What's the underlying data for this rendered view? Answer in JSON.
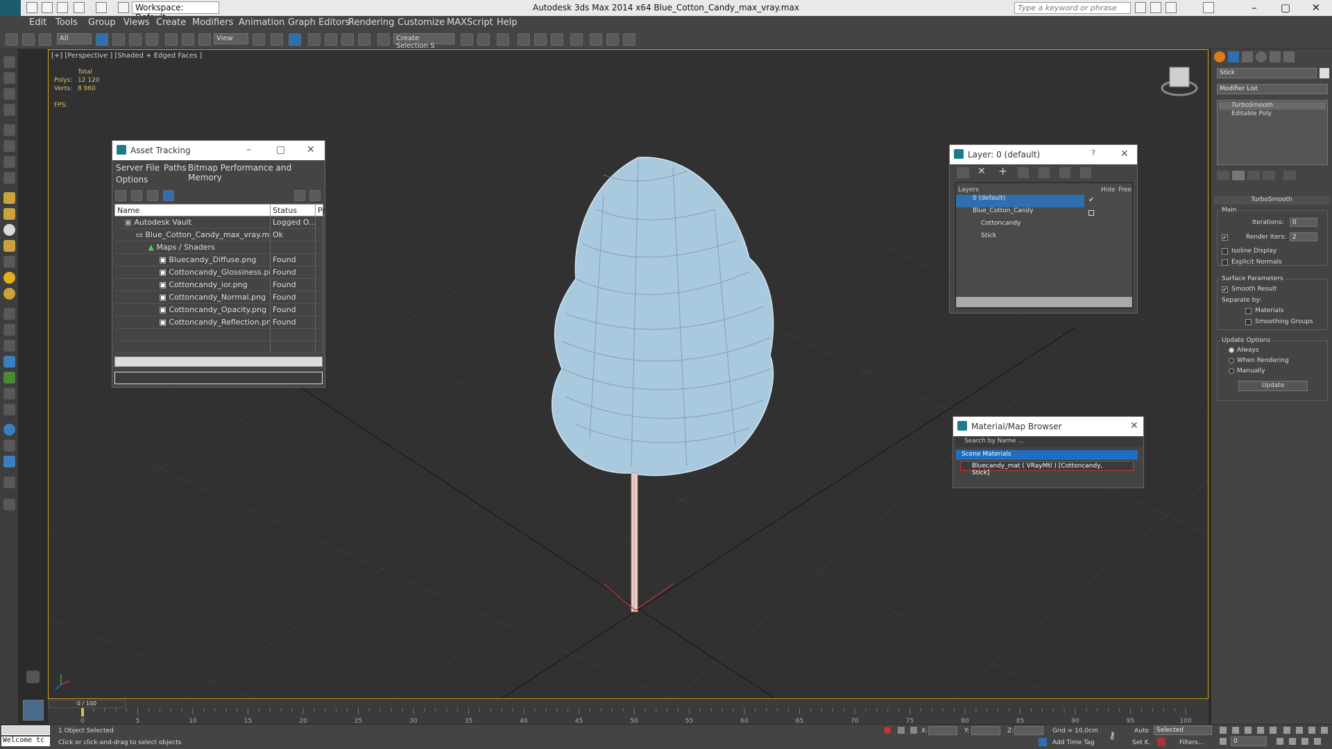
{
  "app": {
    "window_title": "Autodesk 3ds Max  2014 x64      Blue_Cotton_Candy_max_vray.max",
    "workspace": "Workspace: Default",
    "search_placeholder": "Type a keyword or phrase"
  },
  "menu": [
    "Edit",
    "Tools",
    "Group",
    "Views",
    "Create",
    "Modifiers",
    "Animation",
    "Graph Editors",
    "Rendering",
    "Customize",
    "MAXScript",
    "Help"
  ],
  "toolbar": {
    "filter": "All",
    "ref_coord": "View",
    "selection_set": "Create Selection S"
  },
  "viewport": {
    "label": "[+] [Perspective ] [Shaded + Edged Faces ]",
    "stats": {
      "header": "Total",
      "polys_label": "Polys:",
      "polys": "12 120",
      "verts_label": "Verts:",
      "verts": "8 960",
      "fps_label": "FPS:"
    }
  },
  "asset_tracking": {
    "title": "Asset Tracking",
    "menus": [
      "Server",
      "File",
      "Paths",
      "Bitmap Performance and Memory",
      "Options"
    ],
    "columns": [
      "Name",
      "Status",
      "Pr"
    ],
    "rows": [
      {
        "name": "Autodesk Vault",
        "status": "Logged O..."
      },
      {
        "name": "Blue_Cotton_Candy_max_vray.max",
        "status": "Ok"
      },
      {
        "name": "Maps / Shaders",
        "status": ""
      },
      {
        "name": "Bluecandy_Diffuse.png",
        "status": "Found"
      },
      {
        "name": "Cottoncandy_Glossiness.png",
        "status": "Found"
      },
      {
        "name": "Cottoncandy_ior.png",
        "status": "Found"
      },
      {
        "name": "Cottoncandy_Normal.png",
        "status": "Found"
      },
      {
        "name": "Cottoncandy_Opacity.png",
        "status": "Found"
      },
      {
        "name": "Cottoncandy_Reflection.png",
        "status": "Found"
      }
    ]
  },
  "layer_window": {
    "title": "Layer: 0 (default)",
    "col_layers": "Layers",
    "col_hide": "Hide",
    "col_freeze": "Free",
    "rows": [
      "0 (default)",
      "Blue_Cotton_Candy",
      "Cottoncandy",
      "Stick"
    ]
  },
  "material_browser": {
    "title": "Material/Map Browser",
    "search": "Search by Name ...",
    "group": "Scene Materials",
    "item": "Bluecandy_mat  ( VRayMtl )  [Cottoncandy, Stick]"
  },
  "command_panel": {
    "object_name": "Stick",
    "modifier_list": "Modifier List",
    "stack": [
      "TurboSmooth",
      "Editable Poly"
    ],
    "rollout_title": "TurboSmooth",
    "main_label": "Main",
    "iterations_label": "Iterations:",
    "iterations": "0",
    "render_iters_label": "Render Iters:",
    "render_iters": "2",
    "isoline": "Isoline Display",
    "explicit_normals": "Explicit Normals",
    "surface_params": "Surface Parameters",
    "smooth_result": "Smooth Result",
    "separate_by": "Separate by:",
    "materials": "Materials",
    "smoothing_groups": "Smoothing Groups",
    "update_options": "Update Options",
    "always": "Always",
    "when_rendering": "When Rendering",
    "manually": "Manually",
    "update_btn": "Update"
  },
  "timeline": {
    "frame_counter": "0 / 100",
    "ticks": [
      "0",
      "5",
      "10",
      "15",
      "20",
      "25",
      "30",
      "35",
      "40",
      "45",
      "50",
      "55",
      "60",
      "65",
      "70",
      "75",
      "80",
      "85",
      "90",
      "95",
      "100"
    ]
  },
  "status": {
    "listener": "Welcome tc",
    "selected": "1 Object Selected",
    "prompt": "Click or click-and-drag to select objects",
    "x_label": "X:",
    "y_label": "Y:",
    "z_label": "Z:",
    "grid": "Grid = 10,0cm",
    "add_time_tag": "Add Time Tag",
    "auto": "Auto",
    "set_key": "Set K.",
    "selected_dropdown": "Selected",
    "filters": "Filters...",
    "frame": "0"
  }
}
